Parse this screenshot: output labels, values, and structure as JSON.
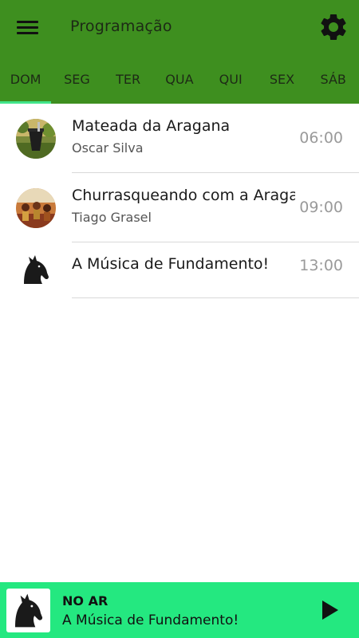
{
  "header": {
    "title": "Programação",
    "menu_icon": "hamburger-menu-icon",
    "settings_icon": "gear-icon"
  },
  "tabs": [
    {
      "label": "DOM",
      "active": true
    },
    {
      "label": "SEG",
      "active": false
    },
    {
      "label": "TER",
      "active": false
    },
    {
      "label": "QUA",
      "active": false
    },
    {
      "label": "QUI",
      "active": false
    },
    {
      "label": "SEX",
      "active": false
    },
    {
      "label": "SÁB",
      "active": false
    }
  ],
  "schedule": [
    {
      "title": "Mateada da Aragana",
      "host": "Oscar Silva",
      "time": "06:00"
    },
    {
      "title": "Churrasqueando com a Aragana",
      "host": "Tiago Grasel",
      "time": "09:00"
    },
    {
      "title": "A Música de Fundamento!",
      "host": "",
      "time": "13:00"
    }
  ],
  "player": {
    "status": "NO AR",
    "title": "A Música de Fundamento!",
    "play_icon": "play-icon"
  },
  "colors": {
    "appbar": "#3e8f1f",
    "tab_indicator": "#42e58a",
    "player_bar": "#24e880"
  }
}
